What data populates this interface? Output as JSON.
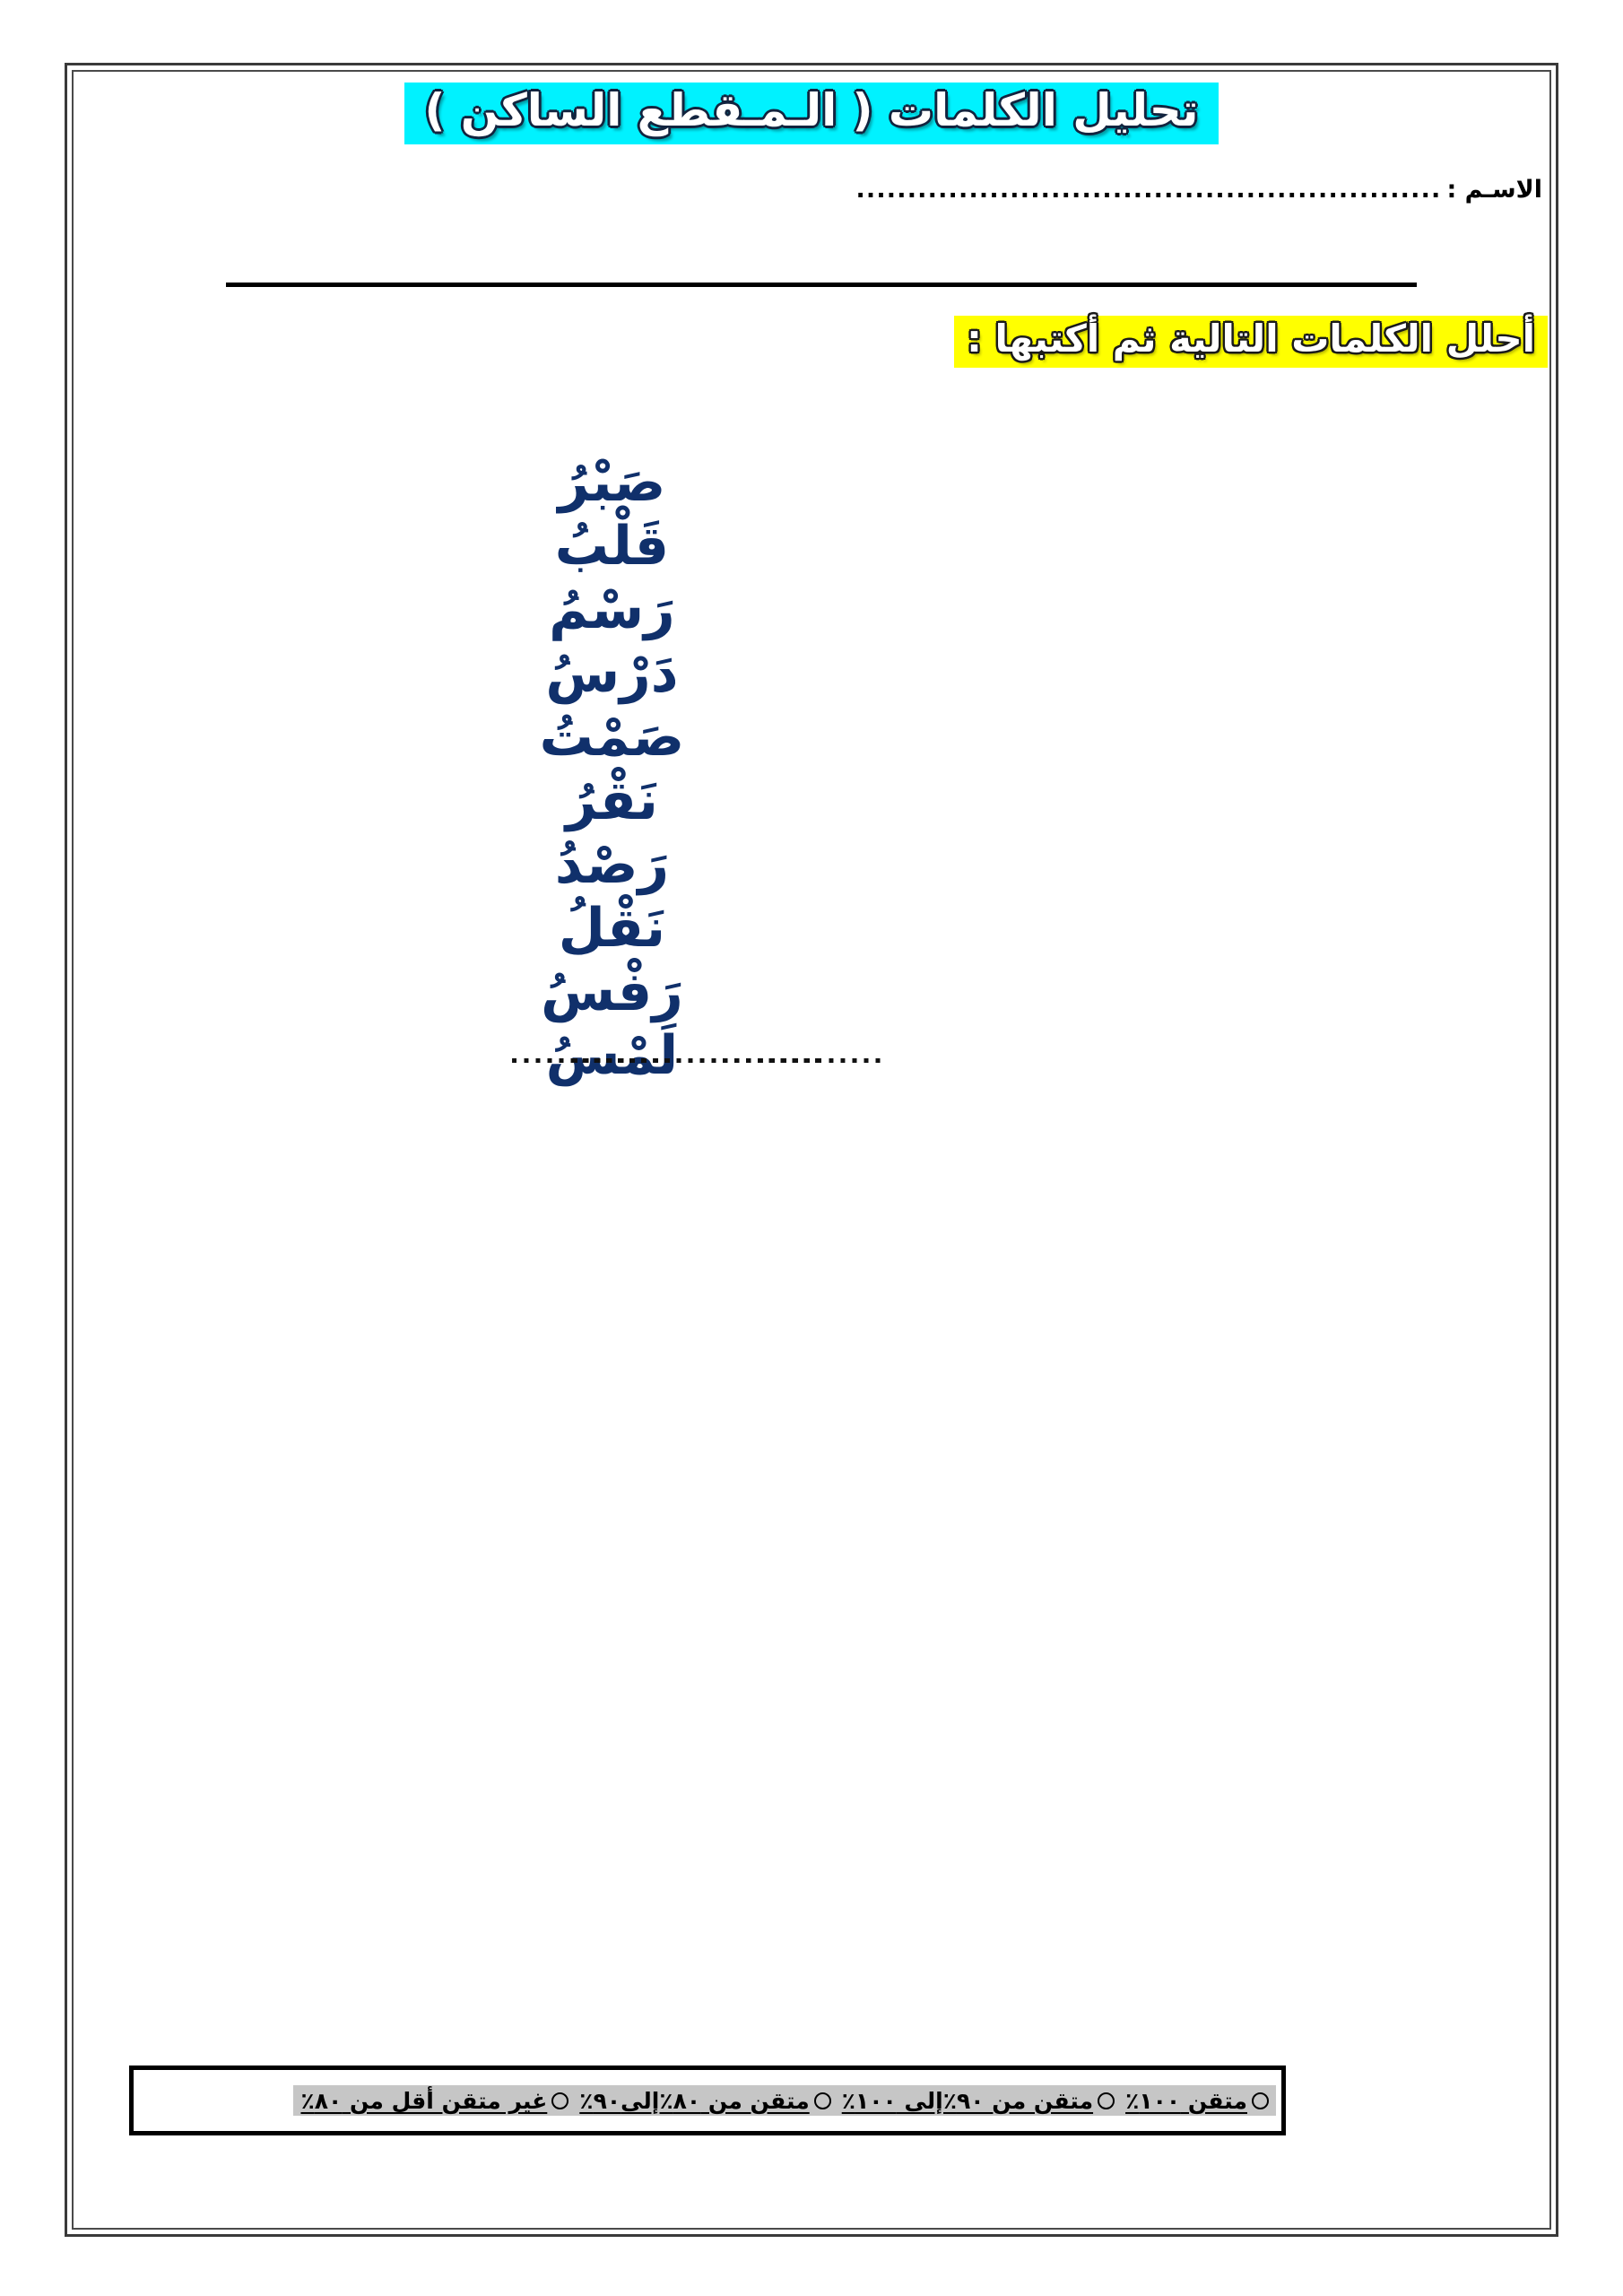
{
  "page": {
    "title_banner": "تحليل الكلمات ( الـمـقطع الساكن )",
    "title_bg_color": "#00F2FF",
    "instruction": "أحلل الكلمات التالية ثم أكتبها :",
    "instruction_bg_color": "#FFFF00",
    "word_color": "#10306B"
  },
  "name_field": {
    "label": "الاسـم :",
    "dots": "........................................................."
  },
  "table": {
    "blank_dots_short": "......................",
    "blank_dots_wide": "................................",
    "rows": [
      {
        "word": "صَبْرُ",
        "blank_1": "......................",
        "blank_2": "......................",
        "blank_3": "................................"
      },
      {
        "word": "قَلْبُ",
        "blank_1": "......................",
        "blank_2": "......................",
        "blank_3": "................................"
      },
      {
        "word": "رَسْمُ",
        "blank_1": "......................",
        "blank_2": "......................",
        "blank_3": "................................"
      },
      {
        "word": "دَرْسُ",
        "blank_1": "......................",
        "blank_2": "......................",
        "blank_3": "................................"
      },
      {
        "word": "صَمْتُ",
        "blank_1": "......................",
        "blank_2": "......................",
        "blank_3": "................................"
      },
      {
        "word": "نَقْرُ",
        "blank_1": "......................",
        "blank_2": "......................",
        "blank_3": "................................"
      },
      {
        "word": "رَصْدُ",
        "blank_1": "......................",
        "blank_2": "......................",
        "blank_3": "................................"
      },
      {
        "word": "نَقْلُ",
        "blank_1": "......................",
        "blank_2": "......................",
        "blank_3": "................................"
      },
      {
        "word": "رَفْسُ",
        "blank_1": "......................",
        "blank_2": "......................",
        "blank_3": "................................"
      },
      {
        "word": "لَمْسُ",
        "blank_1": "......................",
        "blank_2": "......................",
        "blank_3": "................................"
      }
    ]
  },
  "assessment": {
    "options": [
      "متقن ١٠٠٪",
      "متقن من ٩٠٪إلى ١٠٠٪",
      "متقن من ٨٠٪إلى٩٠٪",
      "غير متقن أقل من ٨٠٪"
    ]
  }
}
